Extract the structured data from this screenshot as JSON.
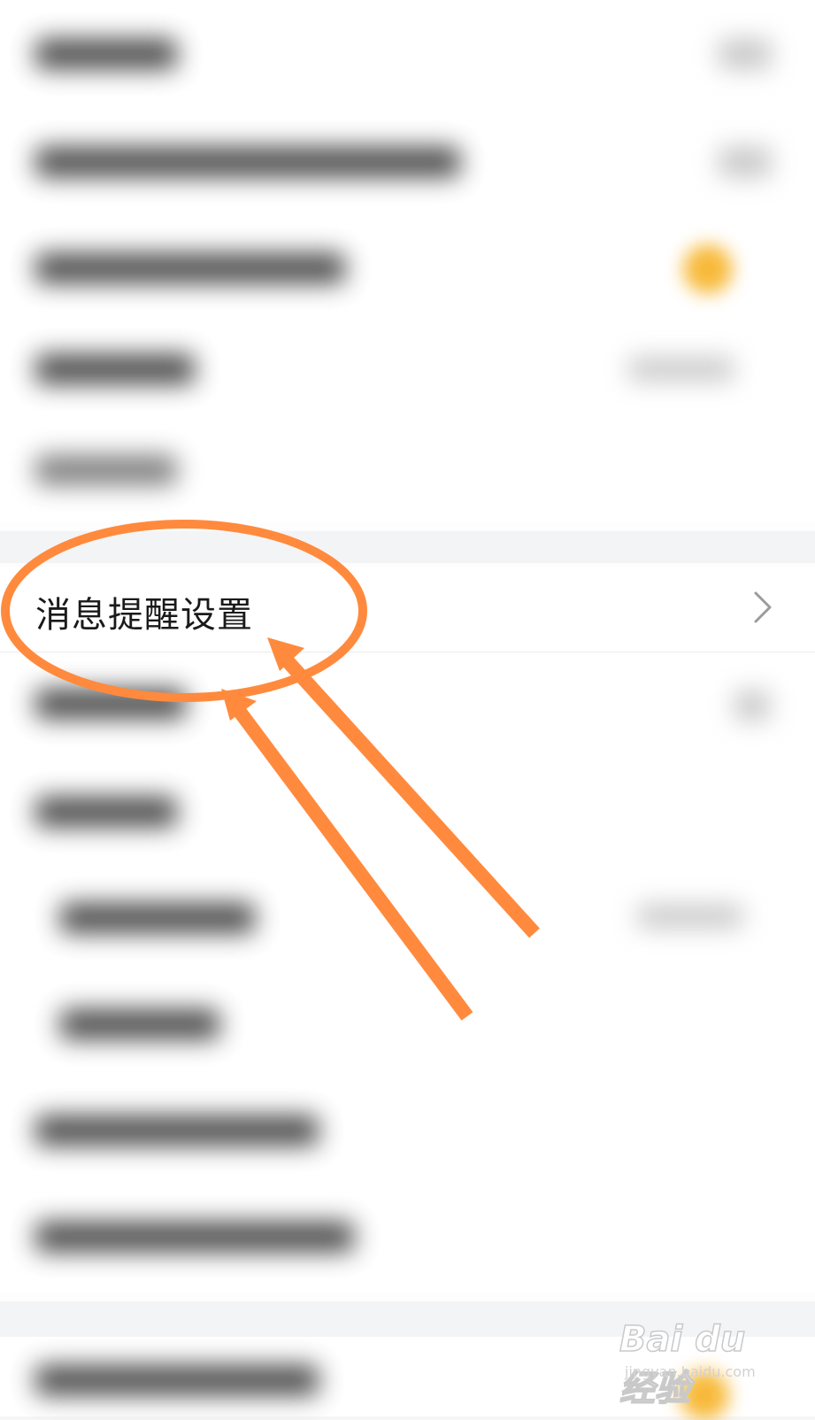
{
  "settings": {
    "focused_item": {
      "label": "消息提醒设置",
      "icon": "chevron-right-icon"
    }
  },
  "annotation": {
    "color": "#ff8a3d",
    "shapes": [
      "ellipse-highlight",
      "arrow",
      "arrow"
    ]
  },
  "watermark": {
    "main": "Bai du 经验",
    "sub": "jingyan.baidu.com"
  }
}
